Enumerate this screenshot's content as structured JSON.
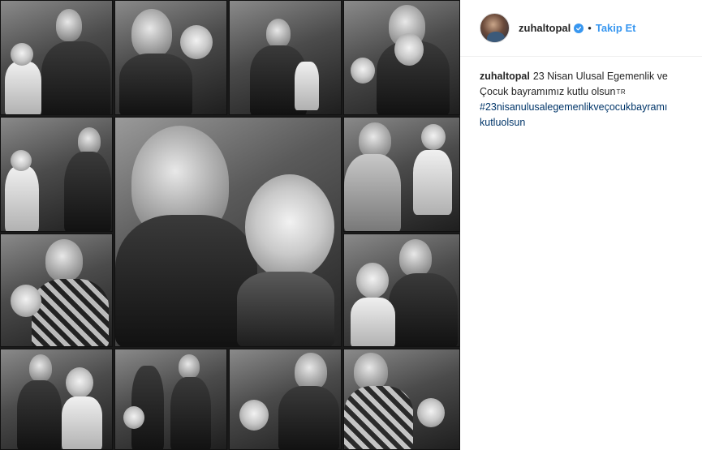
{
  "header": {
    "username": "zuhaltopal",
    "verified_icon": "verified-badge-icon",
    "separator": "•",
    "follow_label": "Takip Et"
  },
  "caption": {
    "username": "zuhaltopal",
    "text": "23 Nisan Ulusal Egemenlik ve Çocuk bayramımız kutlu olsun",
    "flag": "TR",
    "hashtag": "#23nisanulusalegemenlikveçocukbayramı kutluolsun"
  },
  "colors": {
    "link_blue": "#3897f0",
    "hashtag_blue": "#003569",
    "text": "#262626"
  }
}
